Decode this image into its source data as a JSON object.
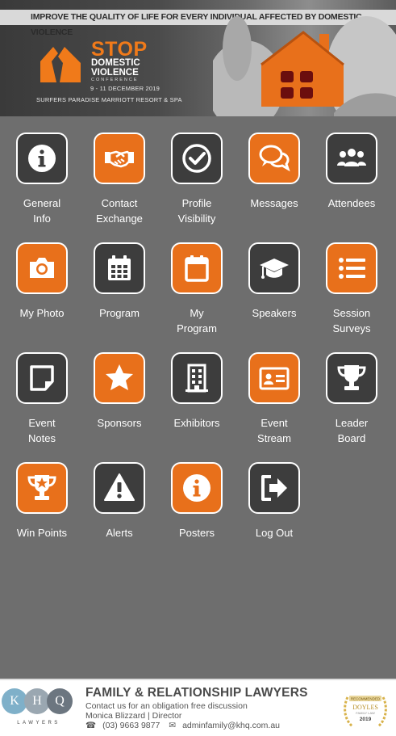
{
  "banner": {
    "tagline": "Improve the quality of life for every individual affected by domestic violence",
    "logo_stop": "STOP",
    "logo_line1": "DOMESTIC",
    "logo_line2": "VIOLENCE",
    "logo_conference": "CONFERENCE",
    "date": "9 - 11 DECEMBER 2019",
    "venue": "Surfers Paradise Marriott Resort & Spa"
  },
  "menu": [
    {
      "label_lines": [
        "General",
        "Info"
      ],
      "icon": "info-icon",
      "style": "dark"
    },
    {
      "label_lines": [
        "Contact",
        "Exchange"
      ],
      "icon": "handshake-icon",
      "style": "orange"
    },
    {
      "label_lines": [
        "Profile",
        "Visibility"
      ],
      "icon": "check-circle-icon",
      "style": "dark"
    },
    {
      "label_lines": [
        "Messages",
        ""
      ],
      "icon": "chat-bubbles-icon",
      "style": "orange"
    },
    {
      "label_lines": [
        "Attendees",
        ""
      ],
      "icon": "people-group-icon",
      "style": "dark"
    },
    {
      "label_lines": [
        "My Photo",
        ""
      ],
      "icon": "camera-icon",
      "style": "orange"
    },
    {
      "label_lines": [
        "Program",
        ""
      ],
      "icon": "calendar-grid-icon",
      "style": "dark"
    },
    {
      "label_lines": [
        "My",
        "Program"
      ],
      "icon": "calendar-icon",
      "style": "orange"
    },
    {
      "label_lines": [
        "Speakers",
        ""
      ],
      "icon": "graduation-cap-icon",
      "style": "dark"
    },
    {
      "label_lines": [
        "Session",
        "Surveys"
      ],
      "icon": "list-icon",
      "style": "orange"
    },
    {
      "label_lines": [
        "Event",
        "Notes"
      ],
      "icon": "sticky-note-icon",
      "style": "dark"
    },
    {
      "label_lines": [
        "Sponsors",
        ""
      ],
      "icon": "star-icon",
      "style": "orange"
    },
    {
      "label_lines": [
        "Exhibitors",
        ""
      ],
      "icon": "building-icon",
      "style": "dark"
    },
    {
      "label_lines": [
        "Event",
        "Stream"
      ],
      "icon": "id-card-icon",
      "style": "orange"
    },
    {
      "label_lines": [
        "Leader",
        "Board"
      ],
      "icon": "trophy-icon",
      "style": "dark"
    },
    {
      "label_lines": [
        "Win Points",
        ""
      ],
      "icon": "trophy-star-icon",
      "style": "orange"
    },
    {
      "label_lines": [
        "Alerts",
        ""
      ],
      "icon": "warning-icon",
      "style": "dark"
    },
    {
      "label_lines": [
        "Posters",
        ""
      ],
      "icon": "info-icon",
      "style": "orange"
    },
    {
      "label_lines": [
        "Log Out",
        ""
      ],
      "icon": "logout-icon",
      "style": "dark"
    }
  ],
  "footer_ad": {
    "logo_letters": [
      "K",
      "H",
      "Q"
    ],
    "logo_sub": "LAWYERS",
    "title": "FAMILY & RELATIONSHIP LAWYERS",
    "line1": "Contact us for an obligation free discussion",
    "line2": "Monica Blizzard | Director",
    "phone": "(03) 9663 9877",
    "email": "adminfamily@khq.com.au",
    "badge_top": "RECOMMENDED",
    "badge_mid": "DOYLES",
    "badge_sub": "FAMILY LAW",
    "badge_year": "2019"
  },
  "colors": {
    "background": "#6e6e6e",
    "orange": "#e8701b",
    "dark_tile": "#3d3d3d",
    "text": "#ffffff"
  }
}
